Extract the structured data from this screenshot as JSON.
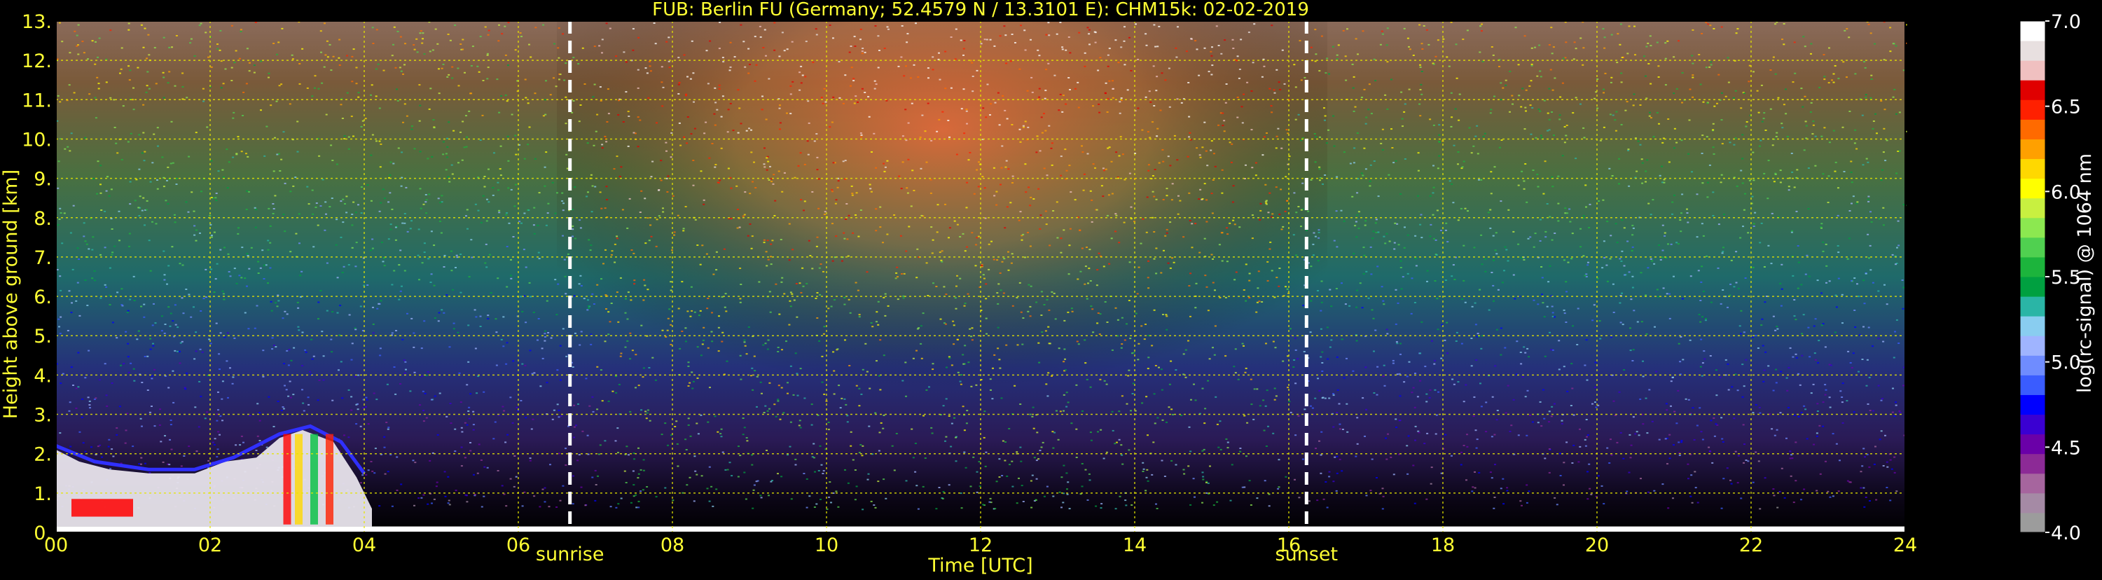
{
  "chart_data": {
    "type": "heatmap",
    "title": "FUB: Berlin FU (Germany; 52.4579 N / 13.3101 E):    CHM15k: 02-02-2019",
    "xlabel": "Time [UTC]",
    "ylabel": "Height above ground [km]",
    "xlim": [
      0,
      24
    ],
    "ylim": [
      0,
      13
    ],
    "x_ticks": [
      0,
      2,
      4,
      6,
      8,
      10,
      12,
      14,
      16,
      18,
      20,
      22,
      24
    ],
    "x_tick_labels": [
      "00",
      "02",
      "04",
      "06",
      "08",
      "10",
      "12",
      "14",
      "16",
      "18",
      "20",
      "22",
      "24"
    ],
    "y_ticks": [
      0,
      1,
      2,
      3,
      4,
      5,
      6,
      7,
      8,
      9,
      10,
      11,
      12,
      13
    ],
    "y_tick_labels": [
      "0.",
      "1.",
      "2.",
      "3.",
      "4.",
      "5.",
      "6.",
      "7.",
      "8.",
      "9.",
      "10.",
      "11.",
      "12.",
      "13."
    ],
    "grid": true,
    "grid_color": "#e6e600",
    "text_color": "#ffff33",
    "annotations": [
      {
        "label": "sunrise",
        "x": 6.67
      },
      {
        "label": "sunset",
        "x": 16.23
      }
    ],
    "colorbar": {
      "label": "log(rc-signal) @ 1064 nm",
      "range": [
        4.0,
        7.0
      ],
      "ticks": [
        4.0,
        4.5,
        5.0,
        5.5,
        6.0,
        6.5,
        7.0
      ],
      "tick_labels": [
        "4.0",
        "4.5",
        "5.0",
        "5.5",
        "6.0",
        "6.5",
        "7.0"
      ],
      "colors": [
        "#9c9c9c",
        "#a58aa5",
        "#a6659e",
        "#8c2a96",
        "#6a00a8",
        "#3a00d2",
        "#0000ff",
        "#3a5cff",
        "#6f8cff",
        "#9fb4ff",
        "#89cdf0",
        "#2ab5a6",
        "#00a040",
        "#1cb43c",
        "#50d050",
        "#8ce850",
        "#c8f040",
        "#ffff00",
        "#ffd800",
        "#ffa000",
        "#ff6a00",
        "#ff2000",
        "#e00000",
        "#f0c0c0",
        "#e8e0e0",
        "#ffffff"
      ]
    }
  }
}
